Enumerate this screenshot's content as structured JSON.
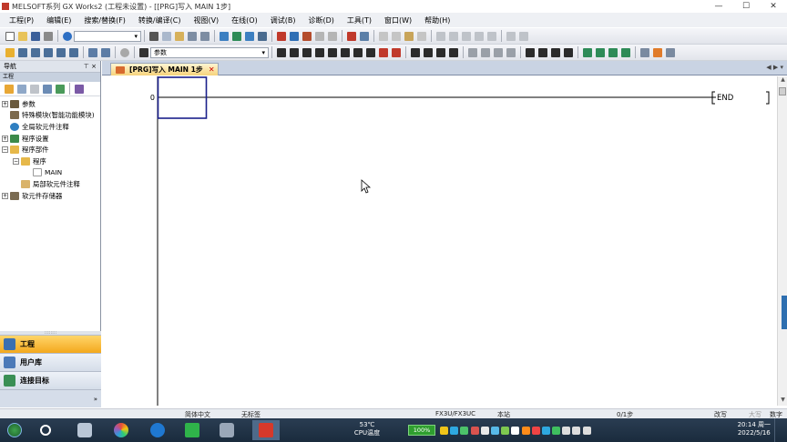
{
  "window": {
    "title": "MELSOFT系列 GX Works2 (工程未设置) - [[PRG]写入 MAIN 1步]",
    "buttons": {
      "minimize": "—",
      "maximize": "☐",
      "close": "✕"
    }
  },
  "menu": [
    "工程(P)",
    "编辑(E)",
    "搜索/替换(F)",
    "转换/编译(C)",
    "视图(V)",
    "在线(O)",
    "调试(B)",
    "诊断(D)",
    "工具(T)",
    "窗口(W)",
    "帮助(H)"
  ],
  "toolbar": {
    "param_combo": "参数"
  },
  "navigation": {
    "title": "导航",
    "pin": "⊤ ×",
    "section": "工程",
    "tree": [
      {
        "label": "参数",
        "expander": "+",
        "level": 0
      },
      {
        "label": "特殊模块(智能功能模块)",
        "expander": "",
        "level": 0
      },
      {
        "label": "全局软元件注释",
        "expander": "",
        "level": 0
      },
      {
        "label": "程序设置",
        "expander": "+",
        "level": 0
      },
      {
        "label": "程序部件",
        "expander": "−",
        "level": 0
      },
      {
        "label": "程序",
        "expander": "−",
        "level": 1
      },
      {
        "label": "MAIN",
        "expander": "",
        "level": 2
      },
      {
        "label": "局部软元件注释",
        "expander": "",
        "level": 1
      },
      {
        "label": "软元件存储器",
        "expander": "+",
        "level": 0
      }
    ],
    "buttons": [
      {
        "label": "工程",
        "active": true
      },
      {
        "label": "用户库",
        "active": false
      },
      {
        "label": "连接目标",
        "active": false
      }
    ],
    "footer": "»"
  },
  "editor": {
    "tab_label": "[PRG]写入 MAIN 1步",
    "tab_close": "✕",
    "tab_nav": "◀ ▶ ▾",
    "step_number": "0",
    "end_instruction": "END"
  },
  "status": {
    "language": "简体中文",
    "label": "无标签",
    "cpu": "FX3U/FX3UC",
    "station": "本站",
    "steps": "0/1步",
    "mode": "改写",
    "caps": "大写",
    "num": "数字"
  },
  "taskbar": {
    "temp_value": "53℃",
    "temp_label": "CPU温度",
    "battery": "100%",
    "time": "20:14 周一",
    "date": "2022/5/16"
  },
  "colors": {
    "menu_bg": "#eef0f4",
    "nav_active": "#f3a81d",
    "tab_bg": "#f6d37c",
    "ladder_cursor": "#1a1f8a",
    "taskbar": "#1a2b3d"
  }
}
